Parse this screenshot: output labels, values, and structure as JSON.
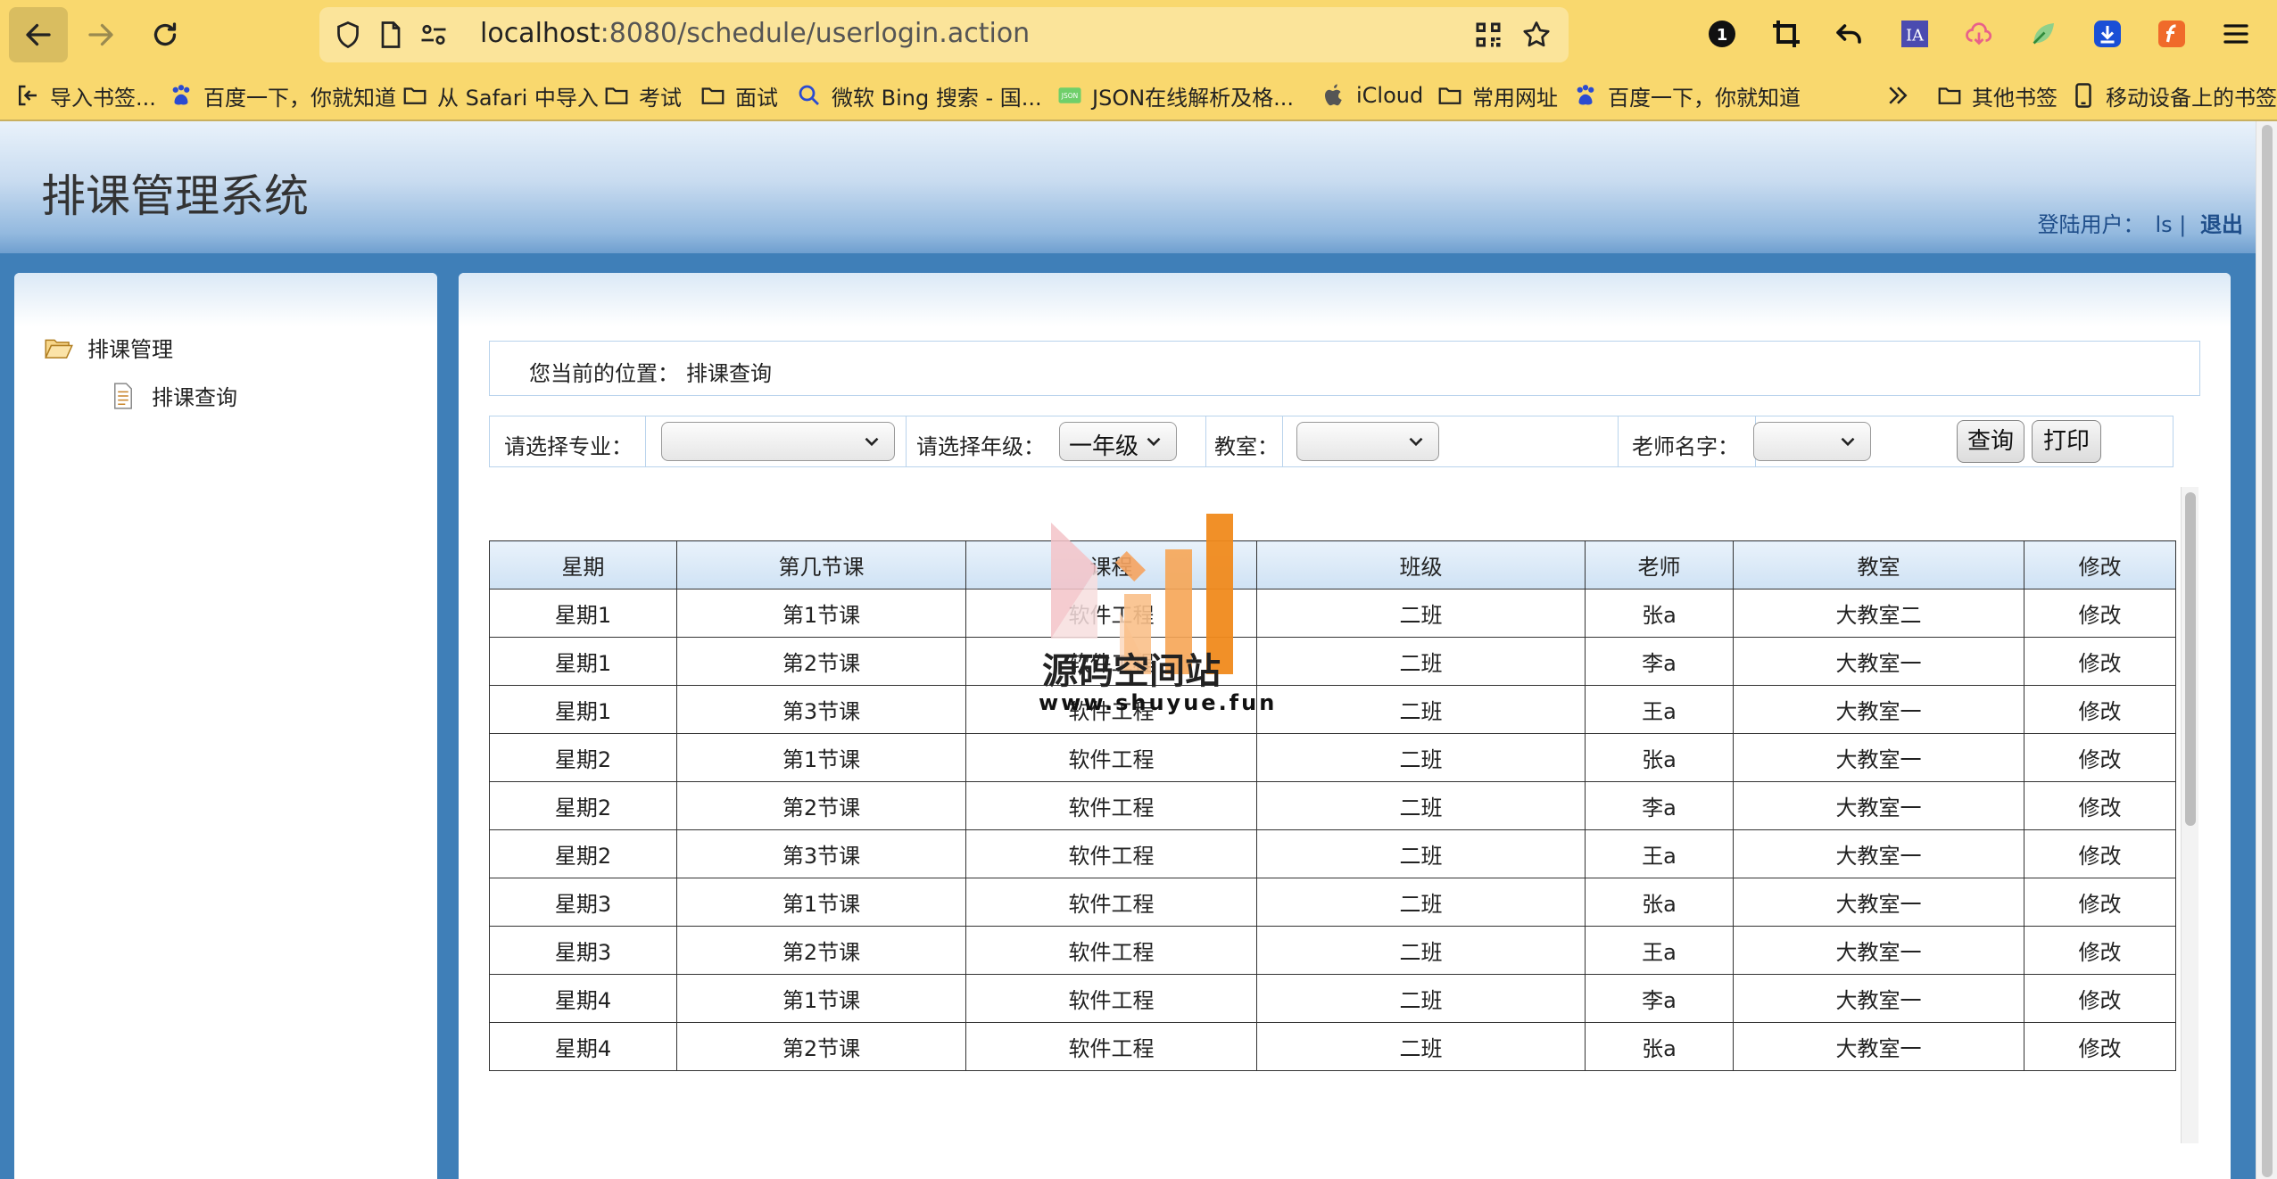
{
  "browser": {
    "url_host": "localhost",
    "url_rest": ":8080/schedule/userlogin.action",
    "bookmarks": [
      "导入书签...",
      "百度一下，你就知道",
      "从 Safari 中导入",
      "考试",
      "面试",
      "微软 Bing 搜索 - 国...",
      "JSON在线解析及格...",
      "iCloud",
      "常用网址",
      "百度一下，你就知道"
    ],
    "other_bookmarks": "其他书签",
    "mobile_bookmarks": "移动设备上的书签",
    "extension_badge": "1",
    "ia_label": "IA",
    "json_badge": "JSON"
  },
  "header": {
    "title": "排课管理系统",
    "user_label": "登陆用户：",
    "user_name": "ls",
    "sep": "|",
    "logout": "退出"
  },
  "sidebar": {
    "root": "排课管理",
    "items": [
      "排课查询"
    ]
  },
  "location": {
    "label": "您当前的位置：",
    "value": "排课查询"
  },
  "filters": {
    "major_label": "请选择专业：",
    "major_value": "",
    "grade_label": "请选择年级：",
    "grade_value": "一年级",
    "room_label": "教室：",
    "room_value": "",
    "teacher_label": "老师名字：",
    "teacher_value": "",
    "query_button": "查询",
    "print_button": "打印"
  },
  "table": {
    "columns": [
      "星期",
      "第几节课",
      "课程",
      "班级",
      "老师",
      "教室",
      "修改"
    ],
    "rows": [
      [
        "星期1",
        "第1节课",
        "软件工程",
        "二班",
        "张a",
        "大教室二",
        "修改"
      ],
      [
        "星期1",
        "第2节课",
        "软件工程",
        "二班",
        "李a",
        "大教室一",
        "修改"
      ],
      [
        "星期1",
        "第3节课",
        "软件工程",
        "二班",
        "王a",
        "大教室一",
        "修改"
      ],
      [
        "星期2",
        "第1节课",
        "软件工程",
        "二班",
        "张a",
        "大教室一",
        "修改"
      ],
      [
        "星期2",
        "第2节课",
        "软件工程",
        "二班",
        "李a",
        "大教室一",
        "修改"
      ],
      [
        "星期2",
        "第3节课",
        "软件工程",
        "二班",
        "王a",
        "大教室一",
        "修改"
      ],
      [
        "星期3",
        "第1节课",
        "软件工程",
        "二班",
        "张a",
        "大教室一",
        "修改"
      ],
      [
        "星期3",
        "第2节课",
        "软件工程",
        "二班",
        "王a",
        "大教室一",
        "修改"
      ],
      [
        "星期4",
        "第1节课",
        "软件工程",
        "二班",
        "李a",
        "大教室一",
        "修改"
      ],
      [
        "星期4",
        "第2节课",
        "软件工程",
        "二班",
        "张a",
        "大教室一",
        "修改"
      ]
    ]
  },
  "watermark": {
    "title": "源码空间站",
    "url": "www.shuyue.fun"
  }
}
